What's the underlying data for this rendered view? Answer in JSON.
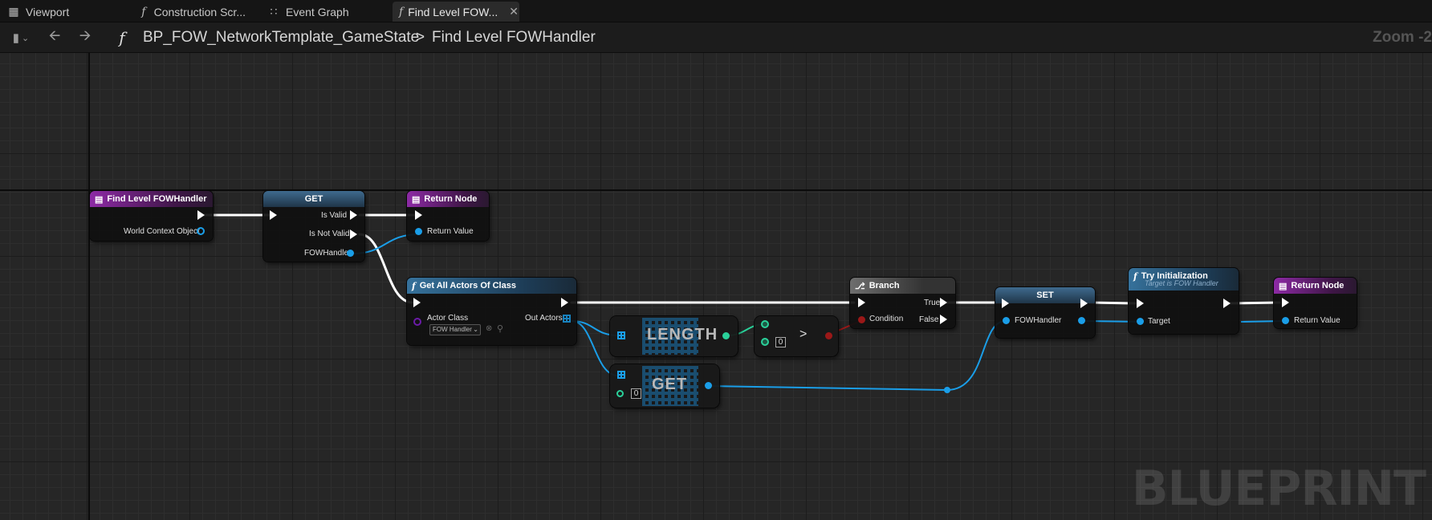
{
  "tabs": [
    {
      "label": "Viewport",
      "icon": "viewport-icon"
    },
    {
      "label": "Construction Scr...",
      "icon": "function-icon"
    },
    {
      "label": "Event Graph",
      "icon": "event-graph-icon"
    },
    {
      "label": "Find Level FOW...",
      "icon": "function-icon",
      "active": true
    }
  ],
  "nav": {
    "breadcrumb_root": "BP_FOW_NetworkTemplate_GameState",
    "breadcrumb_sep": ">",
    "breadcrumb_current": "Find Level FOWHandler",
    "zoom": "Zoom -2"
  },
  "nodes": {
    "entry": {
      "title": "Find Level FOWHandler",
      "pin_world": "World Context Object"
    },
    "get_valid": {
      "title": "GET",
      "pin_valid": "Is Valid",
      "pin_not_valid": "Is Not Valid",
      "pin_handler": "FOWHandler"
    },
    "return1": {
      "title": "Return Node",
      "pin_return": "Return Value"
    },
    "get_all": {
      "title": "Get All Actors Of Class",
      "pin_class": "Actor Class",
      "class_value": "FOW Handler",
      "pin_out": "Out Actors"
    },
    "length": {
      "title": "LENGTH"
    },
    "compare": {
      "op": ">",
      "value": "0"
    },
    "get_index": {
      "title": "GET",
      "index": "0"
    },
    "branch": {
      "title": "Branch",
      "pin_true": "True",
      "pin_condition": "Condition",
      "pin_false": "False"
    },
    "set": {
      "title": "SET",
      "pin_handler": "FOWHandler"
    },
    "try_init": {
      "title": "Try Initialization",
      "subtitle": "Target is FOW Handler",
      "pin_target": "Target"
    },
    "return2": {
      "title": "Return Node",
      "pin_return": "Return Value"
    }
  },
  "watermark": "BLUEPRINT",
  "colors": {
    "exec": "#ffffff",
    "object": "#1a9ee8",
    "int": "#2ad19a",
    "bool": "#9b1818",
    "purple_header": "#8d2aa5",
    "function_header": "#36729c"
  }
}
